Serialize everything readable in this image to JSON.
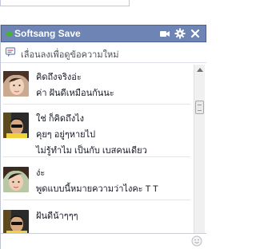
{
  "chat": {
    "title": "Softsang Save",
    "status": "online",
    "header_icons": [
      "video-camera-icon",
      "gear-icon",
      "close-icon"
    ]
  },
  "subbar": {
    "text": "เลื่อนลงเพื่อดูข้อความใหม่",
    "icon": "chat-bubble-icon"
  },
  "messages": [
    {
      "sender": "female",
      "lines": [
        "คิดถึงจริงอ่ะ",
        "ค่า ฝันดีเหมือนกันนะ"
      ]
    },
    {
      "sender": "male",
      "lines": [
        "ใช่ ก็คิดถึงไง",
        "คุยๆ อยู่ๆหายไป",
        "ไม่รู้ทำไม เป็นกับ เบสคนเดียว"
      ]
    },
    {
      "sender": "female",
      "lines": [
        "ง่ะ",
        "พูดแบบนี้หมายความว่าไงคะ T T"
      ]
    },
    {
      "sender": "male",
      "lines": [
        "ฝันดีน้าๆๆๆ"
      ]
    }
  ],
  "colors": {
    "titlebar": "#6d84b4",
    "status_online": "#42b72a"
  }
}
